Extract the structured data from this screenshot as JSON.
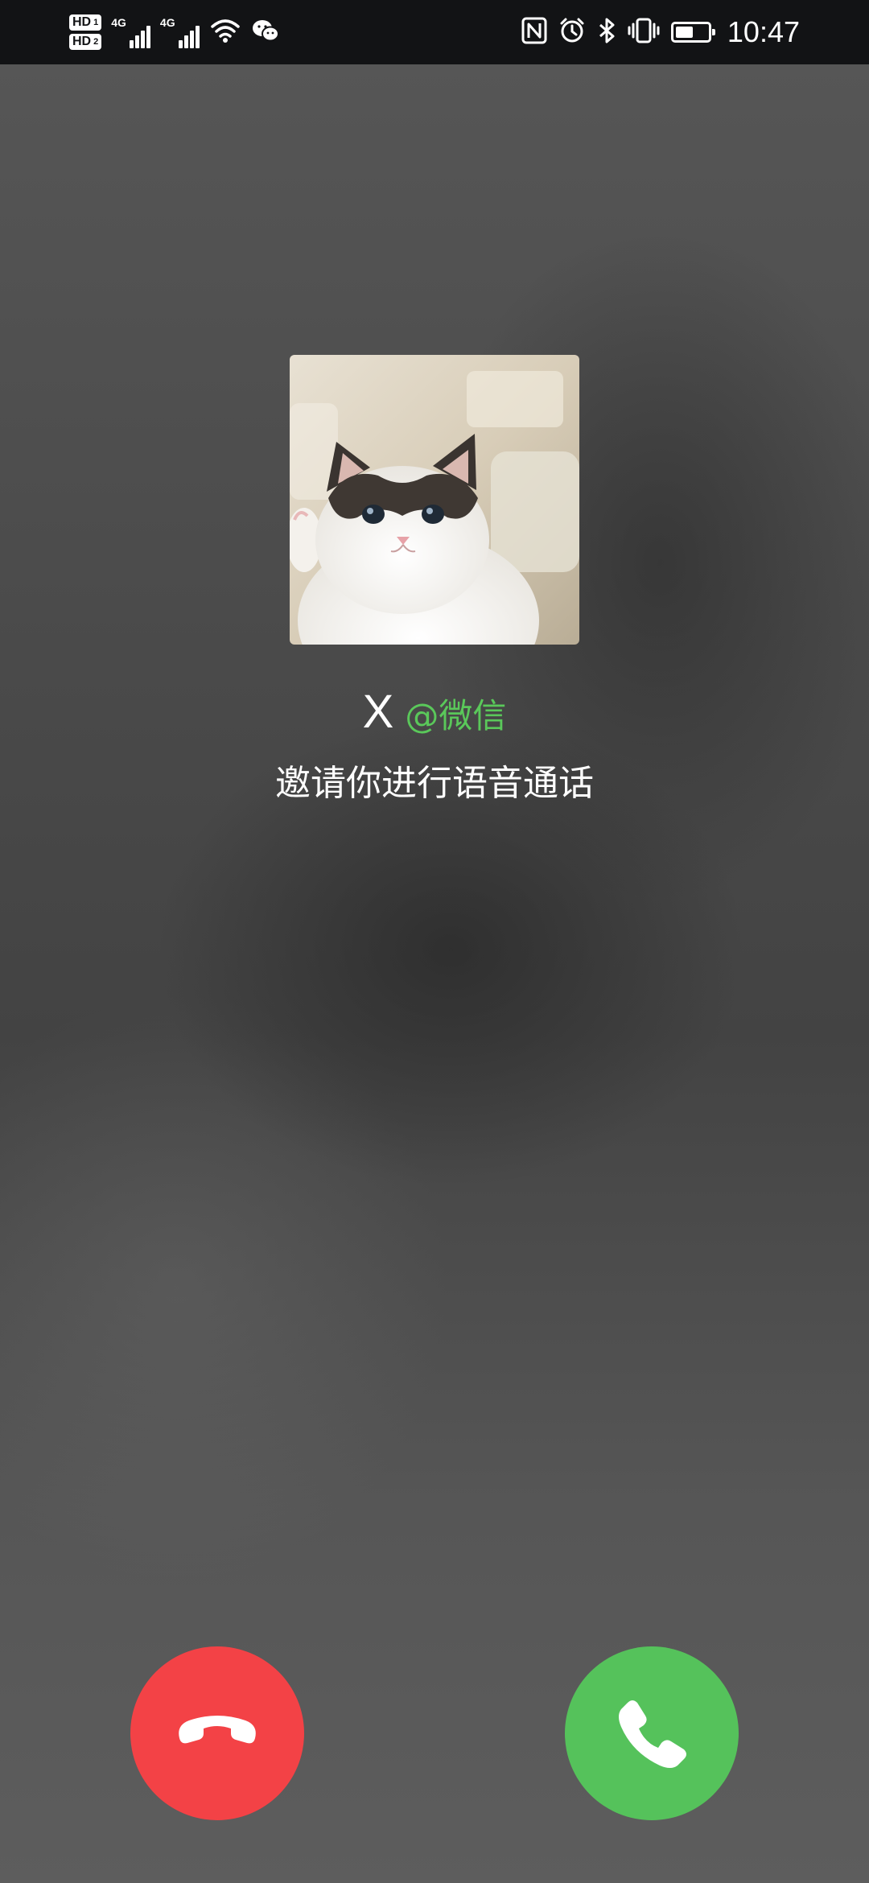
{
  "status_bar": {
    "hd1": "HD",
    "hd1_sim": "1",
    "hd2": "HD",
    "hd2_sim": "2",
    "net1": "4G",
    "net2": "4G",
    "battery_level": 0.55,
    "time": "10:47",
    "icons": [
      "nfc-icon",
      "alarm-icon",
      "bluetooth-icon",
      "vibrate-icon",
      "battery-icon",
      "wifi-icon",
      "wechat-icon"
    ]
  },
  "caller": {
    "name": "X",
    "source": "@微信",
    "invite_text": "邀请你进行语音通话",
    "avatar_icon": "cat-avatar"
  },
  "actions": {
    "decline_icon": "hang-up-icon",
    "accept_icon": "phone-icon"
  },
  "colors": {
    "decline": "#f34246",
    "accept": "#55c25b",
    "source_text": "#5ac85a",
    "status_bar_bg": "#121315"
  }
}
